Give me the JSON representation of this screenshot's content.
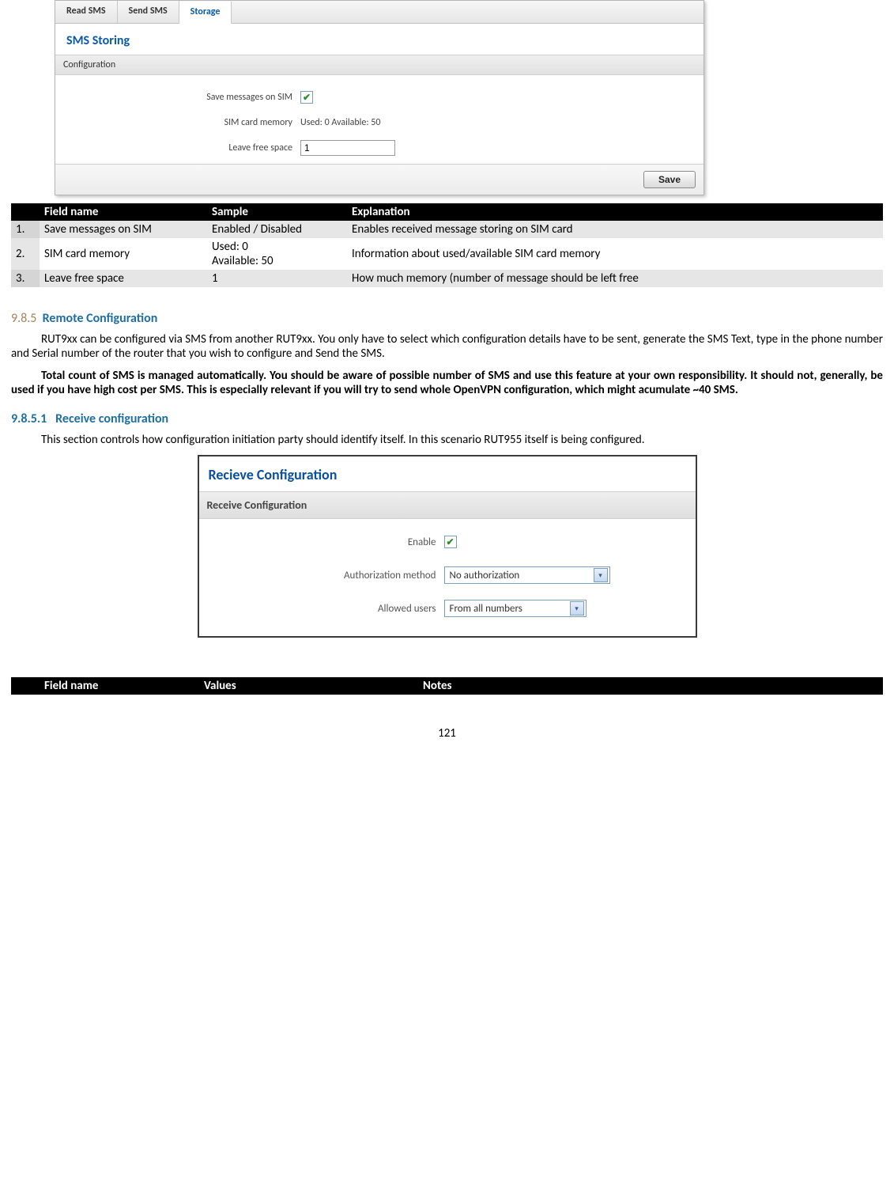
{
  "sms_panel": {
    "tabs": [
      "Read SMS",
      "Send SMS",
      "Storage"
    ],
    "active_tab_index": 2,
    "title": "SMS Storing",
    "section": "Configuration",
    "rows": {
      "save_on_sim_label": "Save messages on SIM",
      "sim_memory_label": "SIM card memory",
      "sim_memory_value": "Used: 0 Available:  50",
      "leave_free_label": "Leave free space",
      "leave_free_value": "1"
    },
    "save_button": "Save"
  },
  "table1": {
    "headers": [
      "",
      "Field name",
      "Sample",
      "Explanation"
    ],
    "rows": [
      {
        "n": "1.",
        "field": "Save messages on SIM",
        "sample": "Enabled / Disabled",
        "explain": "Enables received message storing on SIM card"
      },
      {
        "n": "2.",
        "field": "SIM card memory",
        "sample": "Used: 0\nAvailable: 50",
        "explain": "Information about used/available SIM card memory"
      },
      {
        "n": "3.",
        "field": "Leave free space",
        "sample": "1",
        "explain": "How much memory (number of message should be left free"
      }
    ]
  },
  "section985": {
    "num": "9.8.5",
    "title": "Remote Configuration",
    "para1": "RUT9xx can be configured via SMS from another RUT9xx. You only have to select which configuration details have to be sent, generate the SMS Text, type in the phone number and Serial number of the router that you wish to configure and Send the SMS.",
    "para2": "Total count of SMS is managed automatically. You should be aware of possible number of SMS and use this feature at your own responsibility. It should not, generally, be used if you have high cost per SMS. This is especially relevant if you will try to send whole OpenVPN configuration, which might acumulate ~40 SMS."
  },
  "section9851": {
    "num": "9.8.5.1",
    "title": "Receive configuration",
    "para": "This section controls how configuration initiation party should identify itself. In this scenario RUT955 itself is being configured."
  },
  "recv_panel": {
    "title": "Recieve Configuration",
    "section": "Receive Configuration",
    "enable_label": "Enable",
    "auth_label": "Authorization method",
    "auth_value": "No authorization",
    "allowed_label": "Allowed users",
    "allowed_value": "From all numbers"
  },
  "table2": {
    "headers": [
      "",
      "Field name",
      "Values",
      "Notes"
    ]
  },
  "page_number": "121"
}
